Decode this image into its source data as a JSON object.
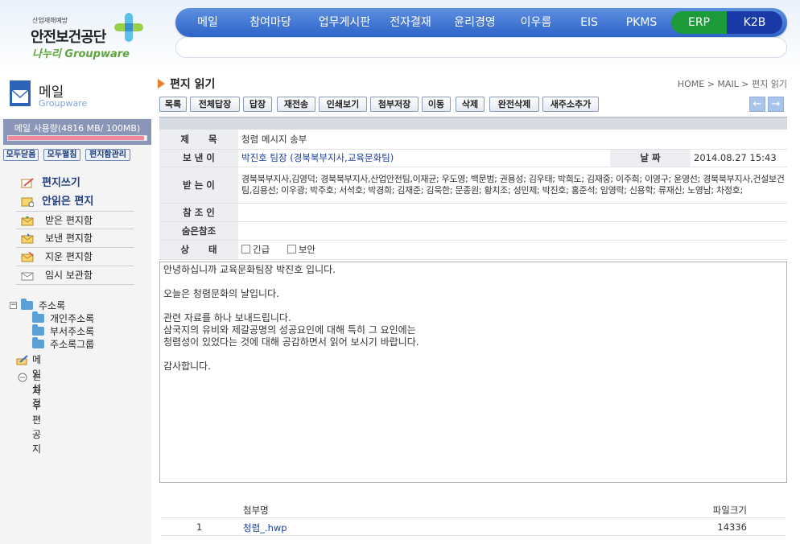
{
  "logo": {
    "small": "산업재해예방",
    "main": "안전보건공단",
    "sub": "나누리 Groupware"
  },
  "nav": [
    "메일",
    "참여마당",
    "업무게시판",
    "전자결재",
    "윤리경영",
    "이우름",
    "EIS",
    "PKMS"
  ],
  "nav_right": [
    "ERP",
    "K2B"
  ],
  "sidebar": {
    "title": "메일",
    "subtitle": "Groupware",
    "usage": "메일 사용량(4816 MB/ 100MB)",
    "usage_fill_fraction": 0.98,
    "buttons": [
      "모두닫음",
      "모두펼침",
      "편지함관리"
    ],
    "write": "편지쓰기",
    "unread": "안읽은 편지",
    "boxes": [
      "받은 편지함",
      "보낸 편지함",
      "지운 편지함",
      "임시 보관함"
    ],
    "addressbook": "주소록",
    "address_children": [
      "개인주소록",
      "부서주소록",
      "주소록그룹"
    ],
    "settings": "메일설정",
    "notice": "전자우편공지"
  },
  "page": {
    "title": "편지 읽기",
    "breadcrumb": "HOME > MAIL > 편지 읽기"
  },
  "toolbar": [
    "목록",
    "전체답장",
    "답장",
    "재전송",
    "인쇄보기",
    "첨부저장",
    "이동",
    "삭제",
    "완전삭제",
    "새주소추가"
  ],
  "mail": {
    "subject_label": "제      목",
    "subject": "청렴 메시지 송부",
    "from_label": "보 낸 이",
    "from": "박진호 팀장 (경북북부지사,교육문화팀)",
    "date_label": "날 짜",
    "date": "2014.08.27 15:43",
    "to_label": "받 는 이",
    "to": "경북북부지사,김영덕; 경북북부지사,산업안전팀,이재균; 우도영; 백문범; 권용성; 김우태; 박희도; 김재중; 이주희; 이영구; 윤영선; 경북북부지사,건설보건팀,김용선; 이우광; 박주호; 서석호; 박경희; 김재준; 김욱한; 문종원; 황치조; 성민제; 박진호; 홍준석; 임영락; 신용학; 류재신; 노영남; 차정호;",
    "cc_label": "참 조 인",
    "cc": "",
    "bcc_label": "숨은참조",
    "bcc": "",
    "status_label": "상      태",
    "status_opts": [
      "긴급",
      "보안"
    ],
    "body": [
      "안녕하십니까  교육문화팀장  박진호 입니다.",
      "",
      "오늘은 청렴문화의 날입니다.",
      "",
      "관련 자료를 하나 보내드립니다.",
      "삼국지의 유비와 제갈공명의 성공요인에 대해 특히 그 요인에는",
      "청렴성이 있었다는 것에 대해 공감하면서 읽어 보시기 바랍니다.",
      "",
      "감사합니다."
    ]
  },
  "attachments": {
    "col_name": "첨부명",
    "col_size": "파일크기",
    "rows": [
      {
        "no": "1",
        "name": "청렴_.hwp",
        "size": "14336"
      }
    ]
  }
}
